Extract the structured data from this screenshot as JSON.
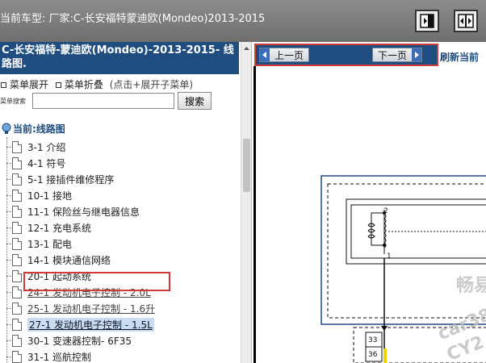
{
  "topbar": {
    "title": "当前车型:   厂家:C-长安福特蒙迪欧(Mondeo)2013-2015",
    "btn_right_panel": "panel-right-icon",
    "btn_split_panel": "split-panel-icon"
  },
  "left": {
    "header": "C-长安福特-蒙迪欧(Mondeo)-2013-2015- 线路图.",
    "expand_all": "菜单展开",
    "collapse_all": "菜单折叠",
    "hint": "(点击+展开子菜单)",
    "search_label": "菜单搜索",
    "search_value": "",
    "search_button": "搜索",
    "tree_root": "当前:线路图",
    "items": [
      {
        "label": "3-1 介绍"
      },
      {
        "label": "4-1 符号"
      },
      {
        "label": "5-1 接插件维修程序"
      },
      {
        "label": "10-1 接地"
      },
      {
        "label": "11-1 保险丝与继电器信息"
      },
      {
        "label": "12-1 充电系统"
      },
      {
        "label": "13-1 配电"
      },
      {
        "label": "14-1 模块通信网络"
      },
      {
        "label": "20-1 起动系统"
      },
      {
        "label": "24-1 发动机电子控制 - 2.0L"
      },
      {
        "label": "25-1 发动机电子控制 - 1.6升"
      },
      {
        "label": "27-1 发动机电子控制 - 1.5L"
      },
      {
        "label": "30-1 变速器控制- 6F35"
      },
      {
        "label": "31-1 巡航控制"
      }
    ]
  },
  "right": {
    "prev_page": "上一页",
    "next_page": "下一页",
    "refresh": "刷新当前",
    "diagram": {
      "pin_top": "2",
      "pin_bottom": "1",
      "connector_a": "33",
      "connector_b": "36"
    },
    "watermarks": [
      "畅易",
      "car38",
      "CY2"
    ]
  },
  "colors": {
    "topbar_bg": "#7d7d7d",
    "header_bg": "#1f4d80",
    "highlight_red": "#d23a3a",
    "selected_bg": "#c8dcf2",
    "nav_arrow": "#3b6db8"
  }
}
